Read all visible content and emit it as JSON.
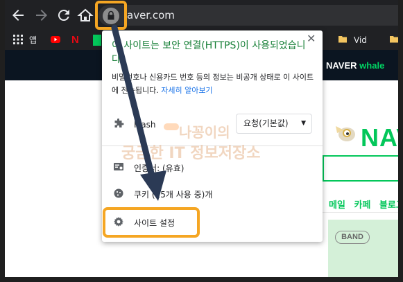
{
  "browser": {
    "url": "naver.com",
    "url_visible": "aver.com",
    "nav": [
      "back",
      "forward",
      "reload",
      "home"
    ]
  },
  "bookmarks": {
    "apps_label": "앱",
    "item_vid": "Vid"
  },
  "page": {
    "whale_prefix": "NAVER",
    "whale_suffix": "whale",
    "logo_text": "NAV",
    "menu_links": [
      "메일",
      "카페",
      "블로그"
    ],
    "band_label": "BAND"
  },
  "popup": {
    "title": "이 사이트는 보안 연결(HTTPS)이 사용되었습니다.",
    "description": "비밀번호나 신용카드 번호 등의 정보는 비공개 상태로 이 사이트에 전송됩니다.",
    "learn_more": "자세히 알아보기",
    "flash_label": "Flash",
    "flash_value": "요청(기본값)",
    "certificate_label": "인증서: (유효)",
    "cookies_label": "쿠키 (15개 사용 중)개",
    "site_settings_label": "사이트 설정"
  },
  "watermark": {
    "line1": "나꽁이의",
    "line2": "궁금한 IT 정보저장소"
  },
  "colors": {
    "chrome_dark": "#202124",
    "secure_green": "#188038",
    "link_blue": "#1a73e8",
    "highlight_orange": "#f5a623",
    "naver_green": "#03c75a",
    "arrow_navy": "#2b3a55"
  }
}
